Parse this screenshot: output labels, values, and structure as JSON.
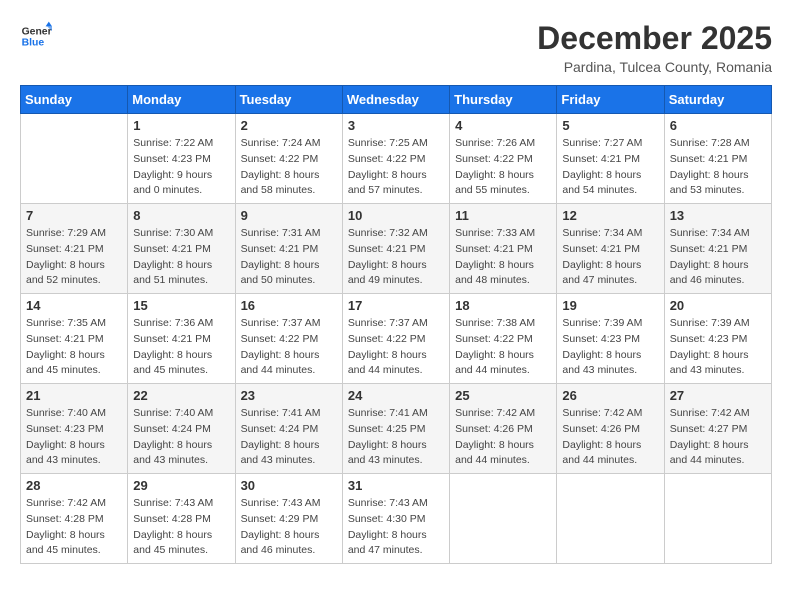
{
  "logo": {
    "line1": "General",
    "line2": "Blue"
  },
  "title": "December 2025",
  "subtitle": "Pardina, Tulcea County, Romania",
  "weekdays": [
    "Sunday",
    "Monday",
    "Tuesday",
    "Wednesday",
    "Thursday",
    "Friday",
    "Saturday"
  ],
  "weeks": [
    [
      {
        "day": "",
        "info": ""
      },
      {
        "day": "1",
        "info": "Sunrise: 7:22 AM\nSunset: 4:23 PM\nDaylight: 9 hours\nand 0 minutes."
      },
      {
        "day": "2",
        "info": "Sunrise: 7:24 AM\nSunset: 4:22 PM\nDaylight: 8 hours\nand 58 minutes."
      },
      {
        "day": "3",
        "info": "Sunrise: 7:25 AM\nSunset: 4:22 PM\nDaylight: 8 hours\nand 57 minutes."
      },
      {
        "day": "4",
        "info": "Sunrise: 7:26 AM\nSunset: 4:22 PM\nDaylight: 8 hours\nand 55 minutes."
      },
      {
        "day": "5",
        "info": "Sunrise: 7:27 AM\nSunset: 4:21 PM\nDaylight: 8 hours\nand 54 minutes."
      },
      {
        "day": "6",
        "info": "Sunrise: 7:28 AM\nSunset: 4:21 PM\nDaylight: 8 hours\nand 53 minutes."
      }
    ],
    [
      {
        "day": "7",
        "info": "Sunrise: 7:29 AM\nSunset: 4:21 PM\nDaylight: 8 hours\nand 52 minutes."
      },
      {
        "day": "8",
        "info": "Sunrise: 7:30 AM\nSunset: 4:21 PM\nDaylight: 8 hours\nand 51 minutes."
      },
      {
        "day": "9",
        "info": "Sunrise: 7:31 AM\nSunset: 4:21 PM\nDaylight: 8 hours\nand 50 minutes."
      },
      {
        "day": "10",
        "info": "Sunrise: 7:32 AM\nSunset: 4:21 PM\nDaylight: 8 hours\nand 49 minutes."
      },
      {
        "day": "11",
        "info": "Sunrise: 7:33 AM\nSunset: 4:21 PM\nDaylight: 8 hours\nand 48 minutes."
      },
      {
        "day": "12",
        "info": "Sunrise: 7:34 AM\nSunset: 4:21 PM\nDaylight: 8 hours\nand 47 minutes."
      },
      {
        "day": "13",
        "info": "Sunrise: 7:34 AM\nSunset: 4:21 PM\nDaylight: 8 hours\nand 46 minutes."
      }
    ],
    [
      {
        "day": "14",
        "info": "Sunrise: 7:35 AM\nSunset: 4:21 PM\nDaylight: 8 hours\nand 45 minutes."
      },
      {
        "day": "15",
        "info": "Sunrise: 7:36 AM\nSunset: 4:21 PM\nDaylight: 8 hours\nand 45 minutes."
      },
      {
        "day": "16",
        "info": "Sunrise: 7:37 AM\nSunset: 4:22 PM\nDaylight: 8 hours\nand 44 minutes."
      },
      {
        "day": "17",
        "info": "Sunrise: 7:37 AM\nSunset: 4:22 PM\nDaylight: 8 hours\nand 44 minutes."
      },
      {
        "day": "18",
        "info": "Sunrise: 7:38 AM\nSunset: 4:22 PM\nDaylight: 8 hours\nand 44 minutes."
      },
      {
        "day": "19",
        "info": "Sunrise: 7:39 AM\nSunset: 4:23 PM\nDaylight: 8 hours\nand 43 minutes."
      },
      {
        "day": "20",
        "info": "Sunrise: 7:39 AM\nSunset: 4:23 PM\nDaylight: 8 hours\nand 43 minutes."
      }
    ],
    [
      {
        "day": "21",
        "info": "Sunrise: 7:40 AM\nSunset: 4:23 PM\nDaylight: 8 hours\nand 43 minutes."
      },
      {
        "day": "22",
        "info": "Sunrise: 7:40 AM\nSunset: 4:24 PM\nDaylight: 8 hours\nand 43 minutes."
      },
      {
        "day": "23",
        "info": "Sunrise: 7:41 AM\nSunset: 4:24 PM\nDaylight: 8 hours\nand 43 minutes."
      },
      {
        "day": "24",
        "info": "Sunrise: 7:41 AM\nSunset: 4:25 PM\nDaylight: 8 hours\nand 43 minutes."
      },
      {
        "day": "25",
        "info": "Sunrise: 7:42 AM\nSunset: 4:26 PM\nDaylight: 8 hours\nand 44 minutes."
      },
      {
        "day": "26",
        "info": "Sunrise: 7:42 AM\nSunset: 4:26 PM\nDaylight: 8 hours\nand 44 minutes."
      },
      {
        "day": "27",
        "info": "Sunrise: 7:42 AM\nSunset: 4:27 PM\nDaylight: 8 hours\nand 44 minutes."
      }
    ],
    [
      {
        "day": "28",
        "info": "Sunrise: 7:42 AM\nSunset: 4:28 PM\nDaylight: 8 hours\nand 45 minutes."
      },
      {
        "day": "29",
        "info": "Sunrise: 7:43 AM\nSunset: 4:28 PM\nDaylight: 8 hours\nand 45 minutes."
      },
      {
        "day": "30",
        "info": "Sunrise: 7:43 AM\nSunset: 4:29 PM\nDaylight: 8 hours\nand 46 minutes."
      },
      {
        "day": "31",
        "info": "Sunrise: 7:43 AM\nSunset: 4:30 PM\nDaylight: 8 hours\nand 47 minutes."
      },
      {
        "day": "",
        "info": ""
      },
      {
        "day": "",
        "info": ""
      },
      {
        "day": "",
        "info": ""
      }
    ]
  ]
}
